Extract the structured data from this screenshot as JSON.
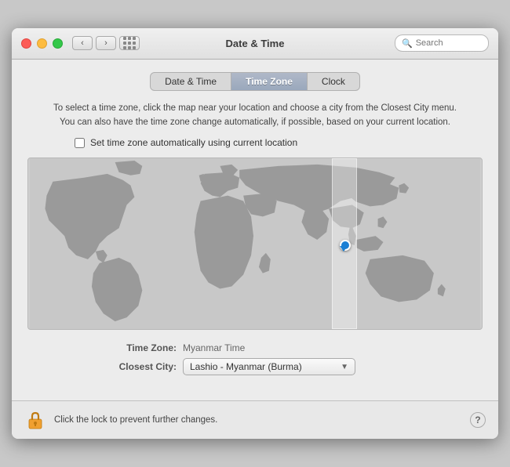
{
  "titlebar": {
    "title": "Date & Time"
  },
  "search": {
    "placeholder": "Search"
  },
  "tabs": [
    {
      "id": "date-time",
      "label": "Date & Time",
      "active": false
    },
    {
      "id": "time-zone",
      "label": "Time Zone",
      "active": true
    },
    {
      "id": "clock",
      "label": "Clock",
      "active": false
    }
  ],
  "description": {
    "line1": "To select a time zone, click the map near your location and choose a city from the Closest City menu.",
    "line2": "You can also have the time zone change automatically, if possible, based on your current location."
  },
  "checkbox": {
    "label": "Set time zone automatically using current location"
  },
  "fields": {
    "timezone_label": "Time Zone:",
    "timezone_value": "Myanmar Time",
    "closest_city_label": "Closest City:",
    "closest_city_value": "Lashio - Myanmar (Burma)"
  },
  "bottom": {
    "lock_text": "Click the lock to prevent further changes.",
    "help_label": "?"
  }
}
